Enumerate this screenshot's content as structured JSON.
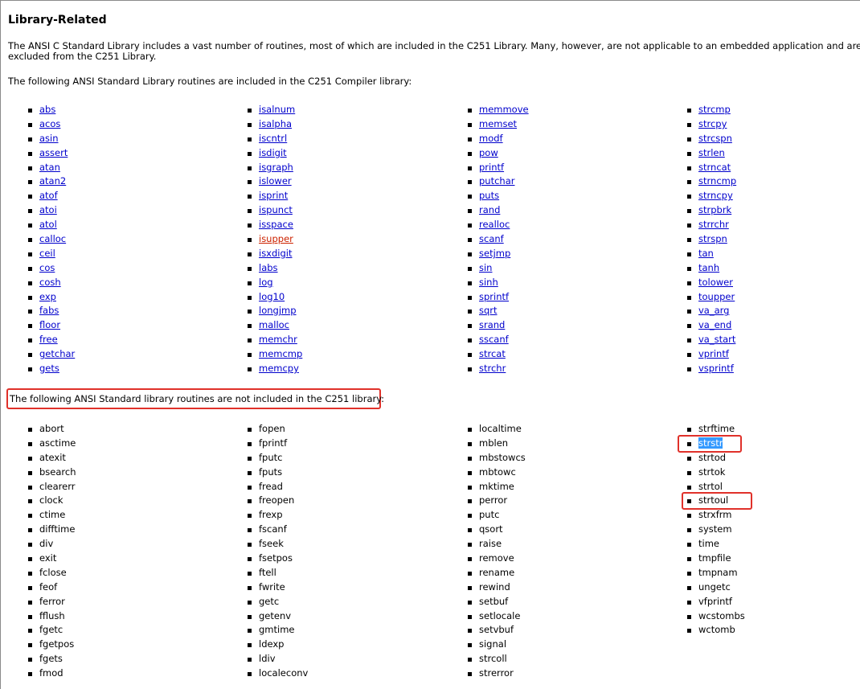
{
  "heading": "Library-Related",
  "intro": "The ANSI C Standard Library includes a vast number of routines, most of which are included in the C251 Library. Many, however, are not applicable to an embedded application and are excluded from the C251 Library.",
  "included_caption": "The following ANSI Standard Library routines are included in the C251 Compiler library:",
  "excluded_caption": "The following ANSI Standard library routines are not included in the C251 library:",
  "colors": {
    "link": "#0000cc",
    "visited_link": "#cc2200",
    "highlight_box": "#e0312a",
    "selection": "#3399ff"
  },
  "included": [
    [
      "abs",
      "acos",
      "asin",
      "assert",
      "atan",
      "atan2",
      "atof",
      "atoi",
      "atol",
      "calloc",
      "ceil",
      "cos",
      "cosh",
      "exp",
      "fabs",
      "floor",
      "free",
      "getchar",
      "gets"
    ],
    [
      "isalnum",
      "isalpha",
      "iscntrl",
      "isdigit",
      "isgraph",
      "islower",
      "isprint",
      "ispunct",
      "isspace",
      "isupper",
      "isxdigit",
      "labs",
      "log",
      "log10",
      "longjmp",
      "malloc",
      "memchr",
      "memcmp",
      "memcpy"
    ],
    [
      "memmove",
      "memset",
      "modf",
      "pow",
      "printf",
      "putchar",
      "puts",
      "rand",
      "realloc",
      "scanf",
      "setjmp",
      "sin",
      "sinh",
      "sprintf",
      "sqrt",
      "srand",
      "sscanf",
      "strcat",
      "strchr"
    ],
    [
      "strcmp",
      "strcpy",
      "strcspn",
      "strlen",
      "strncat",
      "strncmp",
      "strncpy",
      "strpbrk",
      "strrchr",
      "strspn",
      "tan",
      "tanh",
      "tolower",
      "toupper",
      "va_arg",
      "va_end",
      "va_start",
      "vprintf",
      "vsprintf"
    ]
  ],
  "excluded": [
    [
      "abort",
      "asctime",
      "atexit",
      "bsearch",
      "clearerr",
      "clock",
      "ctime",
      "difftime",
      "div",
      "exit",
      "fclose",
      "feof",
      "ferror",
      "fflush",
      "fgetc",
      "fgetpos",
      "fgets",
      "fmod"
    ],
    [
      "fopen",
      "fprintf",
      "fputc",
      "fputs",
      "fread",
      "freopen",
      "frexp",
      "fscanf",
      "fseek",
      "fsetpos",
      "ftell",
      "fwrite",
      "getc",
      "getenv",
      "gmtime",
      "ldexp",
      "ldiv",
      "localeconv"
    ],
    [
      "localtime",
      "mblen",
      "mbstowcs",
      "mbtowc",
      "mktime",
      "perror",
      "putc",
      "qsort",
      "raise",
      "remove",
      "rename",
      "rewind",
      "setbuf",
      "setlocale",
      "setvbuf",
      "signal",
      "strcoll",
      "strerror"
    ],
    [
      "strftime",
      "strstr",
      "strtod",
      "strtok",
      "strtol",
      "strtoul",
      "strxfrm",
      "system",
      "time",
      "tmpfile",
      "tmpnam",
      "ungetc",
      "vfprintf",
      "wcstombs",
      "wctomb"
    ]
  ]
}
